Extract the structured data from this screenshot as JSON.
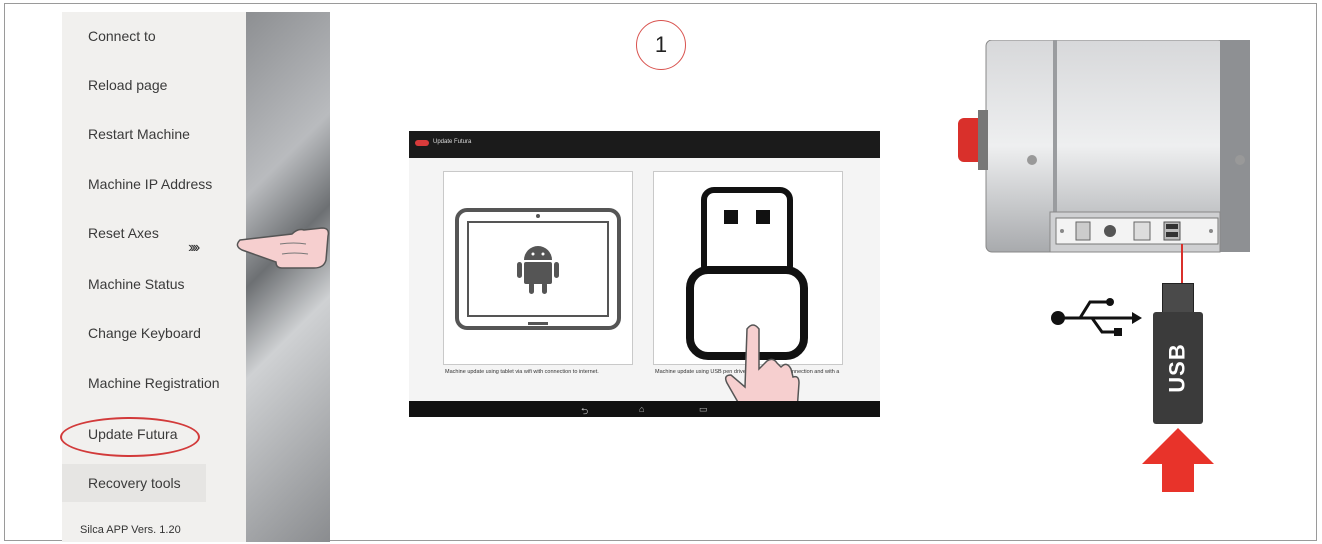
{
  "menu": {
    "items": [
      {
        "label": "Connect to"
      },
      {
        "label": "Reload page"
      },
      {
        "label": "Restart Machine"
      },
      {
        "label": "Machine IP Address"
      },
      {
        "label": "Reset Axes"
      },
      {
        "label": "Machine Status"
      },
      {
        "label": "Change Keyboard"
      },
      {
        "label": "Machine Registration"
      },
      {
        "label": "Update Futura"
      },
      {
        "label": "Recovery tools"
      }
    ],
    "version": "Silca APP Vers. 1.20",
    "pointer_arrows": "››››"
  },
  "step": {
    "number": "1"
  },
  "tablet": {
    "title": "Update Futura",
    "option_left_caption": "Machine update using tablet via wifi with connection to internet.",
    "option_right_caption": "Machine update using USB pen drive without internet connection and with a"
  },
  "usb": {
    "label": "USB"
  },
  "colors": {
    "accent_red": "#d23a3a",
    "arrow_red": "#e8332a",
    "dark_bar": "#1b1b1b"
  },
  "icons": [
    "android-icon",
    "usb-icon",
    "hand-pointer-icon",
    "usb-symbol-icon",
    "back-icon",
    "home-icon",
    "recents-icon",
    "up-arrow-icon"
  ]
}
